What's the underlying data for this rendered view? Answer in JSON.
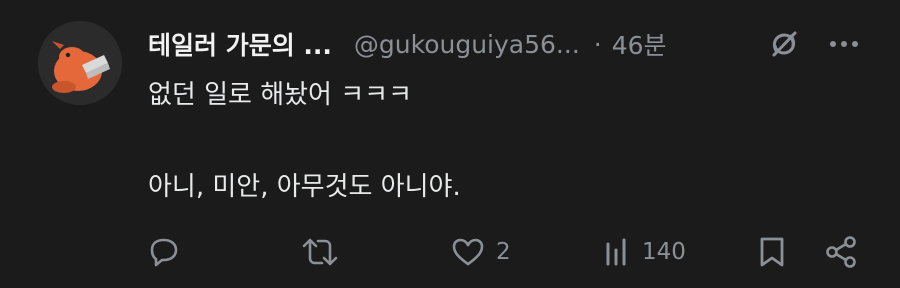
{
  "tweet": {
    "display_name": "테일러 가문의 ...",
    "handle": "@gukouguiya56...",
    "separator": "·",
    "time": "46분",
    "lines": [
      "없던 일로 해놨어 ㅋㅋㅋ",
      "아니, 미안, 아무것도 아니야."
    ]
  },
  "actions": {
    "reply_count": "",
    "retweet_count": "",
    "like_count": "2",
    "views_count": "140"
  },
  "icons": {
    "avatar": "chainsaw-dog-avatar",
    "grok": "grok-icon",
    "more": "more-icon",
    "reply": "reply-icon",
    "retweet": "retweet-icon",
    "like": "heart-icon",
    "views": "views-icon",
    "bookmark": "bookmark-icon",
    "share": "share-icon"
  },
  "colors": {
    "background": "#1b1b1b",
    "text": "#e7e9ea",
    "muted": "#8b9096"
  }
}
